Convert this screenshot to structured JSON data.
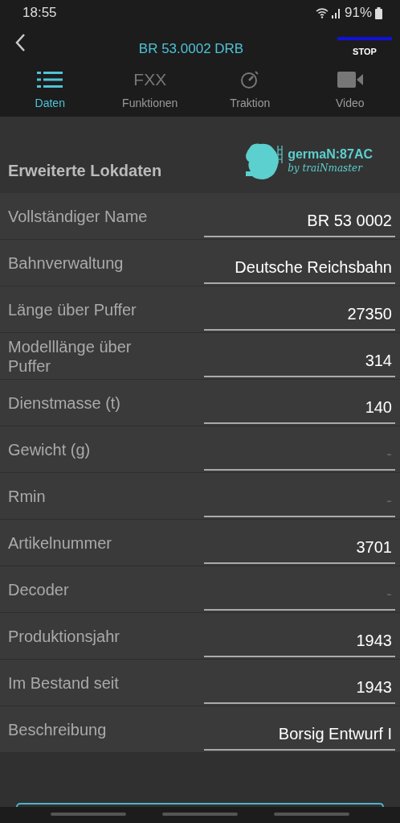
{
  "status_bar": {
    "time": "18:55",
    "battery": "91%"
  },
  "header": {
    "title": "BR 53.0002 DRB",
    "stop_label": "STOP"
  },
  "tabs": [
    {
      "label": "Daten",
      "kind": "list",
      "selected": true
    },
    {
      "label": "Funktionen",
      "kind": "text",
      "icon_text": "FXX",
      "selected": false
    },
    {
      "label": "Traktion",
      "kind": "gauge",
      "selected": false
    },
    {
      "label": "Video",
      "kind": "camera",
      "selected": false
    }
  ],
  "section": {
    "title": "Erweiterte Lokdaten",
    "logo_name": "germaN:87AC",
    "logo_tagline": "by traiNmaster"
  },
  "fields": [
    {
      "label": "Vollständiger Name",
      "value": "BR 53 0002"
    },
    {
      "label": "Bahnverwaltung",
      "value": "Deutsche Reichsbahn"
    },
    {
      "label": "Länge über Puffer",
      "value": "27350"
    },
    {
      "label": "Modelllänge über Puffer",
      "value": "314"
    },
    {
      "label": "Dienstmasse (t)",
      "value": "140"
    },
    {
      "label": "Gewicht (g)",
      "placeholder": "-"
    },
    {
      "label": "Rmin",
      "placeholder": "-"
    },
    {
      "label": "Artikelnummer",
      "value": "3701"
    },
    {
      "label": "Decoder",
      "placeholder": "-"
    },
    {
      "label": "Produktionsjahr",
      "value": "1943"
    },
    {
      "label": "Im Bestand seit",
      "value": "1943"
    },
    {
      "label": "Beschreibung",
      "value": "Borsig Entwurf I"
    }
  ]
}
